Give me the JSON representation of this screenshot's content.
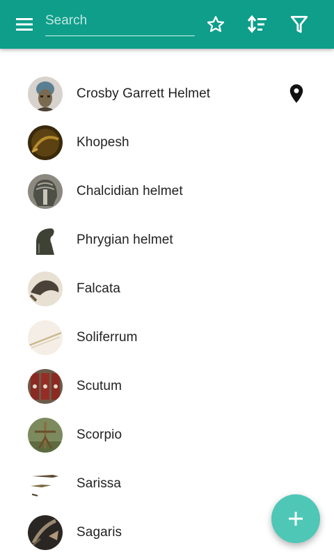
{
  "toolbar": {
    "search_placeholder": "Search",
    "search_value": "",
    "icons": [
      "menu-icon",
      "star-icon",
      "sort-icon",
      "filter-icon"
    ],
    "background_color": "#0e9e8a"
  },
  "items": [
    {
      "name": "Crosby Garrett Helmet",
      "has_location": true
    },
    {
      "name": "Khopesh",
      "has_location": false
    },
    {
      "name": "Chalcidian helmet",
      "has_location": false
    },
    {
      "name": "Phrygian helmet",
      "has_location": false
    },
    {
      "name": "Falcata",
      "has_location": false
    },
    {
      "name": "Soliferrum",
      "has_location": false
    },
    {
      "name": "Scutum",
      "has_location": false
    },
    {
      "name": "Scorpio",
      "has_location": false
    },
    {
      "name": "Sarissa",
      "has_location": false
    },
    {
      "name": "Sagaris",
      "has_location": false
    }
  ],
  "fab": {
    "icon": "plus-icon",
    "color": "#4fc7b6"
  }
}
